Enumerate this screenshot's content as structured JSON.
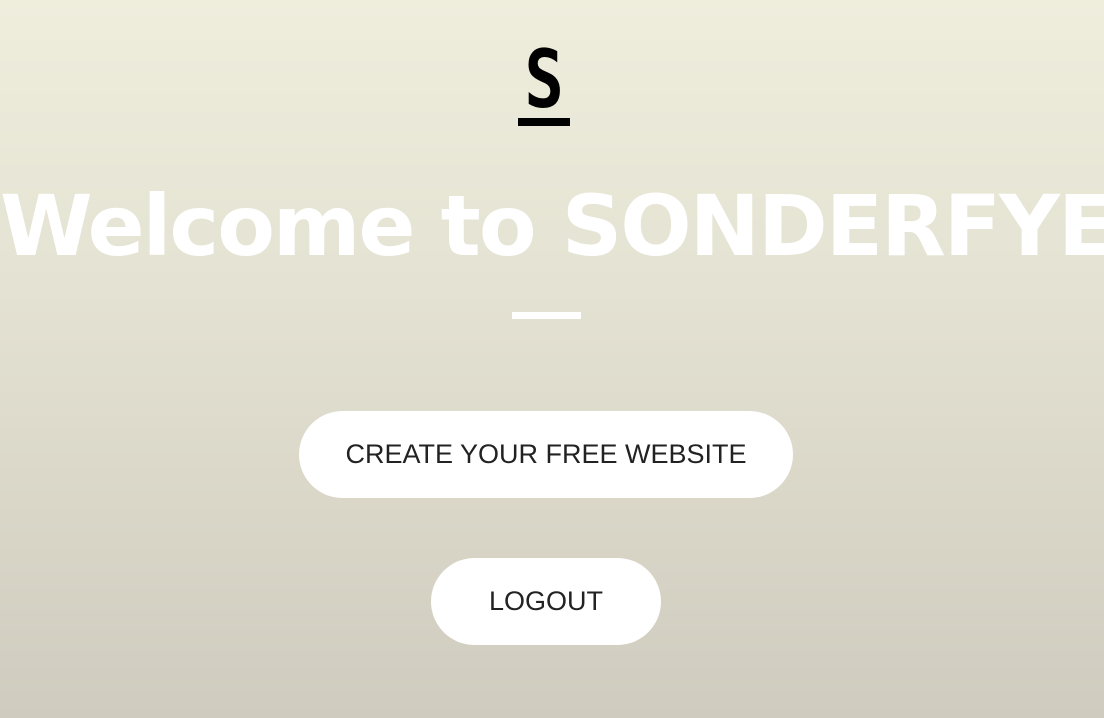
{
  "logo": {
    "letter": "S",
    "icon": "s-logo-icon"
  },
  "hero": {
    "headline": "Welcome to SONDERFYE"
  },
  "actions": {
    "create_label": "CREATE YOUR FREE WEBSITE",
    "logout_label": "LOGOUT"
  },
  "colors": {
    "background_top": "#efeddc",
    "background_bottom": "#cfccbf",
    "headline": "#ffffff",
    "button_bg": "#ffffff",
    "button_text": "#222222",
    "logo": "#000000"
  }
}
